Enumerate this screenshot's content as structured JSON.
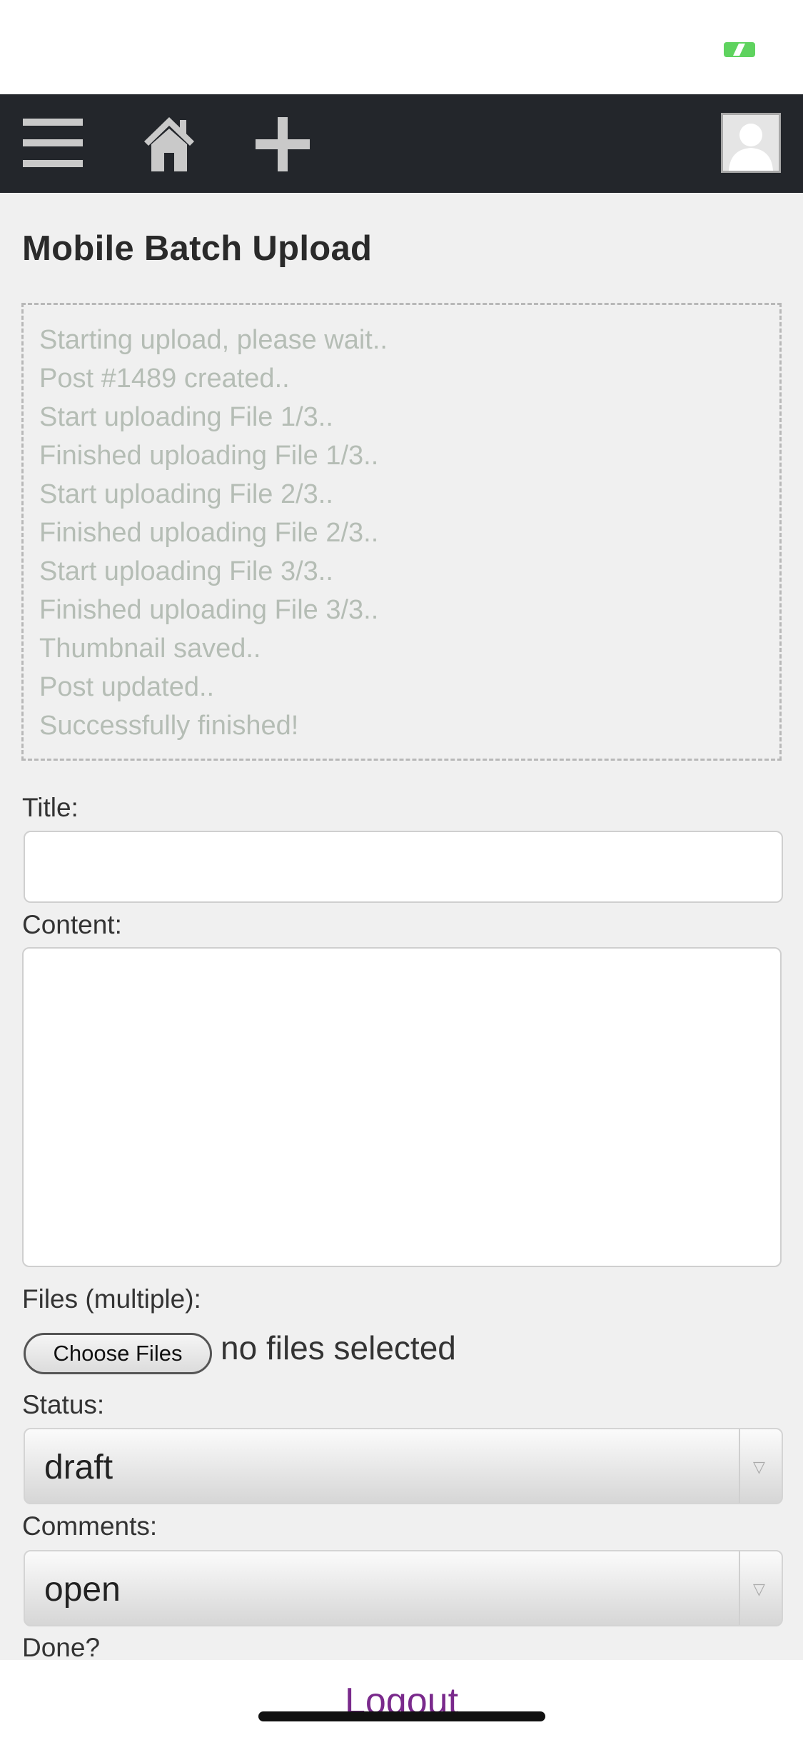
{
  "nav": {
    "icons": [
      "hamburger-menu-icon",
      "home-icon",
      "plus-icon",
      "user-avatar-icon"
    ]
  },
  "page": {
    "title": "Mobile Batch Upload"
  },
  "log": [
    "Starting upload, please wait..",
    "Post #1489 created..",
    "Start uploading File 1/3..",
    "Finished uploading File 1/3..",
    "Start uploading File 2/3..",
    "Finished uploading File 2/3..",
    "Start uploading File 3/3..",
    "Finished uploading File 3/3..",
    "Thumbnail saved..",
    "Post updated..",
    "Successfully finished!"
  ],
  "form": {
    "title_label": "Title:",
    "title_value": "",
    "content_label": "Content:",
    "content_value": "",
    "files_label": "Files (multiple):",
    "choose_files_label": "Choose Files",
    "files_status": "no files selected",
    "status_label": "Status:",
    "status_value": "draft",
    "comments_label": "Comments:",
    "comments_value": "open",
    "done_label": "Done?"
  },
  "footer": {
    "logout_label": "Logout"
  },
  "colors": {
    "navbar_bg": "#23262b",
    "page_bg": "#f0f0f0",
    "log_text": "#b5bdb5",
    "logout_link": "#7a2a8c",
    "battery": "#5fd35f"
  }
}
